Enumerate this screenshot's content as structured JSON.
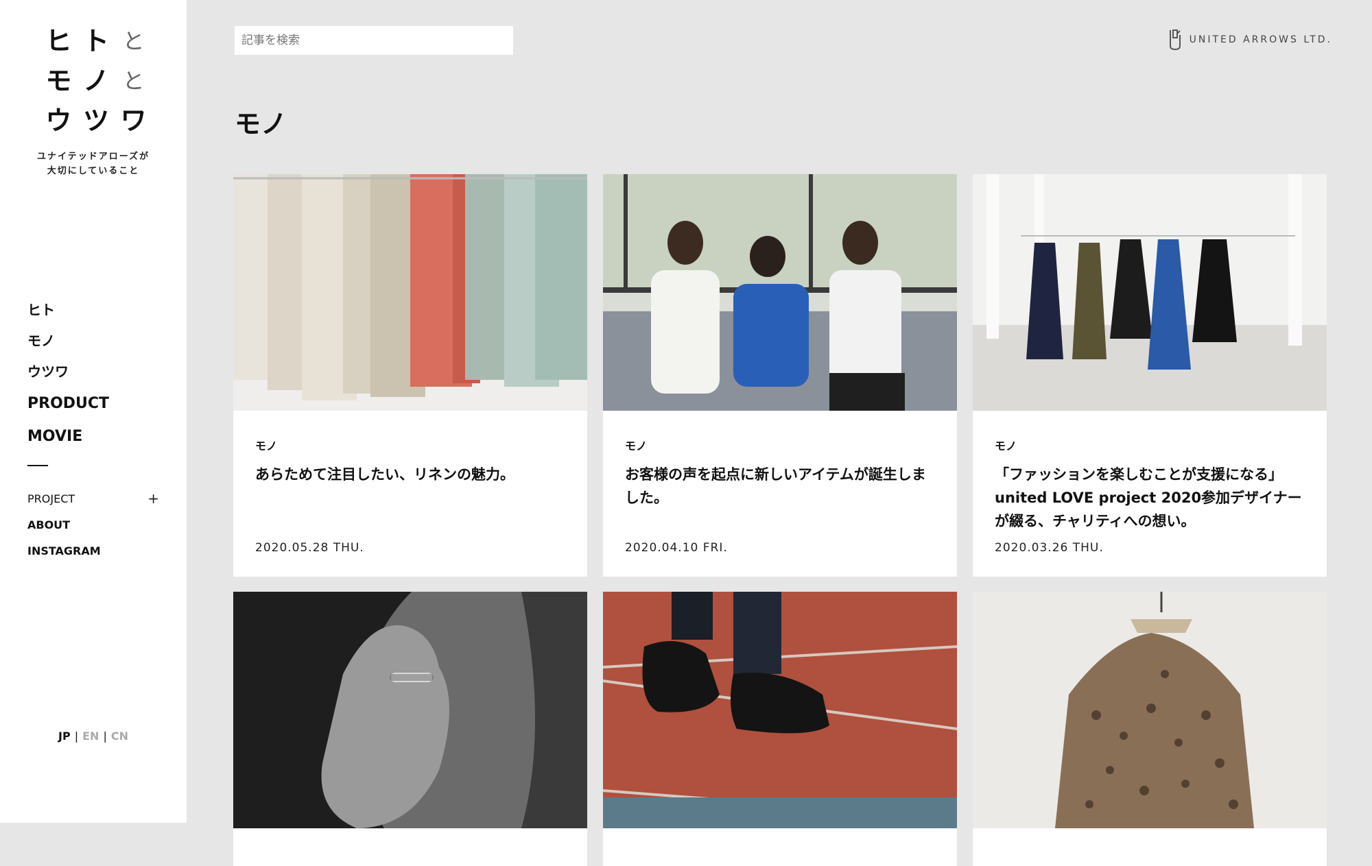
{
  "site": {
    "logo_chars": [
      "ヒ",
      "ト",
      "と",
      "モ",
      "ノ",
      "と",
      "ウ",
      "ツ",
      "ワ"
    ],
    "tagline_line1": "ユナイテッドアローズが",
    "tagline_line2": "大切にしていること"
  },
  "nav": {
    "main": [
      "ヒト",
      "モノ",
      "ウツワ",
      "PRODUCT",
      "MOVIE"
    ],
    "project": "PROJECT",
    "project_toggle": "+",
    "about": "ABOUT",
    "instagram": "INSTAGRAM"
  },
  "lang": {
    "jp": "JP",
    "en": "EN",
    "cn": "CN",
    "sep": "|"
  },
  "search": {
    "placeholder": "記事を検索"
  },
  "brand": {
    "name": "UNITED ARROWS LTD."
  },
  "section": {
    "title": "モノ"
  },
  "articles": [
    {
      "category": "モノ",
      "title": "あらためて注目したい、リネンの魅力。",
      "date": "2020.05.28 THU."
    },
    {
      "category": "モノ",
      "title": "お客様の声を起点に新しいアイテムが誕生しました。",
      "date": "2020.04.10 FRI."
    },
    {
      "category": "モノ",
      "title": "「ファッションを楽しむことが支援になる」united LOVE project 2020参加デザイナーが綴る、チャリティへの想い。",
      "date": "2020.03.26 THU."
    }
  ],
  "colors": {
    "page_bg": "#e6e6e6",
    "sidebar_bg": "#ffffff",
    "text": "#111111",
    "inactive": "#aaaaaa"
  }
}
